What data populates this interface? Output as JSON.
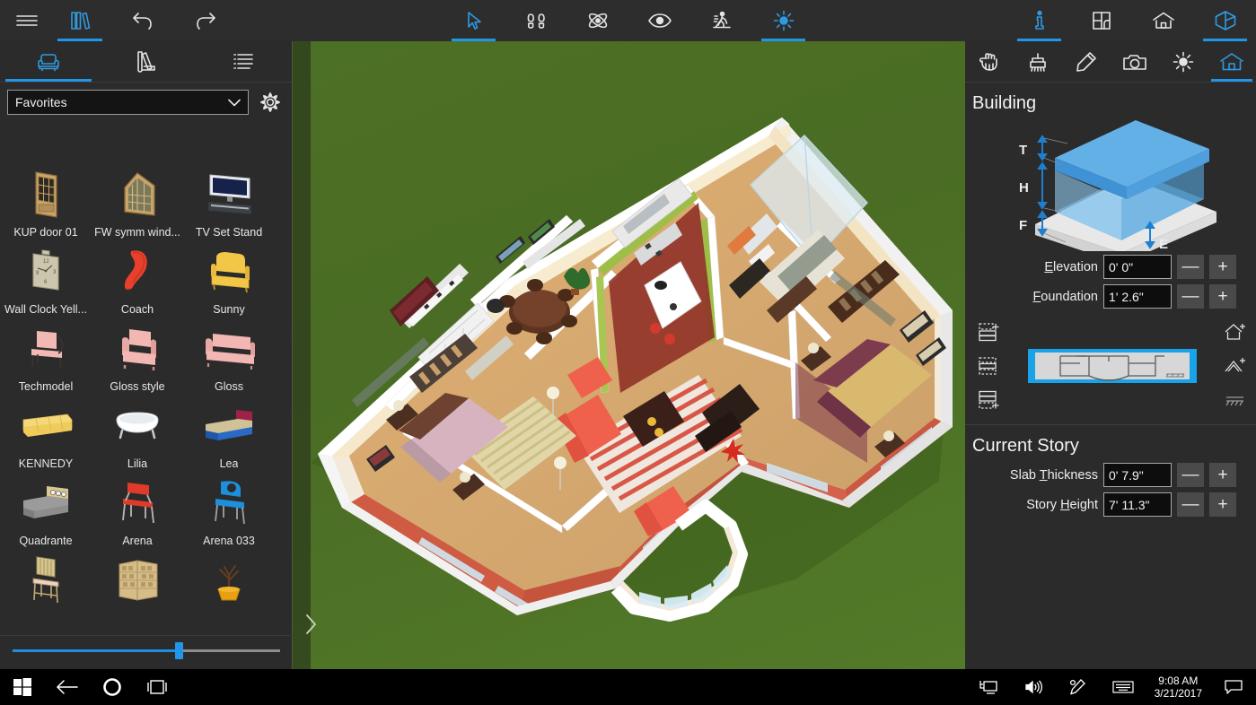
{
  "app": {
    "name": "Live Home 3D",
    "accent": "#2196e8"
  },
  "topbar": {
    "left": [
      {
        "name": "menu-icon",
        "label": "Menu",
        "active": false
      },
      {
        "name": "library-icon",
        "label": "Library",
        "active": true
      },
      {
        "name": "undo-icon",
        "label": "Undo",
        "active": false
      },
      {
        "name": "redo-icon",
        "label": "Redo",
        "active": false
      }
    ],
    "center": [
      {
        "name": "select-arrow-icon",
        "label": "Select",
        "active": true
      },
      {
        "name": "footprints-icon",
        "label": "Walk",
        "active": false
      },
      {
        "name": "atom-orbit-icon",
        "label": "Orbit",
        "active": false
      },
      {
        "name": "eye-icon",
        "label": "Look",
        "active": false
      },
      {
        "name": "person-ramp-icon",
        "label": "Elevation",
        "active": false
      },
      {
        "name": "sun-icon",
        "label": "Lighting",
        "active": true
      }
    ],
    "right": [
      {
        "name": "info-icon",
        "label": "Info",
        "active": true
      },
      {
        "name": "floorplan-icon",
        "label": "Floor Plan",
        "active": false
      },
      {
        "name": "house-icon",
        "label": "Interior",
        "active": false
      },
      {
        "name": "cube-3d-icon",
        "label": "3D View",
        "active": true
      }
    ]
  },
  "left_panel": {
    "tabs": [
      {
        "name": "objects-tab",
        "icon": "armchair-icon",
        "label": "Objects",
        "active": true
      },
      {
        "name": "materials-tab",
        "icon": "swatch-icon",
        "label": "Materials",
        "active": false
      },
      {
        "name": "list-tab",
        "icon": "list-icon",
        "label": "List",
        "active": false
      }
    ],
    "category": {
      "value": "Favorites",
      "chevron": "⌄"
    },
    "settings_label": "Settings",
    "items": [
      {
        "label": "KUP door 01",
        "icon": "door-thumb"
      },
      {
        "label": "FW symm wind...",
        "icon": "window-thumb"
      },
      {
        "label": "TV Set Stand",
        "icon": "tv-thumb"
      },
      {
        "label": "Wall Clock Yell...",
        "icon": "clock-thumb"
      },
      {
        "label": "Coach",
        "icon": "redchair-thumb"
      },
      {
        "label": "Sunny",
        "icon": "yellowarmchair-thumb"
      },
      {
        "label": "Techmodel",
        "icon": "pinkchair-thumb"
      },
      {
        "label": "Gloss style",
        "icon": "pinkarmchair-thumb"
      },
      {
        "label": "Gloss",
        "icon": "pinksofa-thumb"
      },
      {
        "label": "KENNEDY",
        "icon": "yellowsofa-thumb"
      },
      {
        "label": "Lilia",
        "icon": "bathtub-thumb"
      },
      {
        "label": "Lea",
        "icon": "bed-thumb"
      },
      {
        "label": "Quadrante",
        "icon": "graybed-thumb"
      },
      {
        "label": "Arena",
        "icon": "redchair2-thumb"
      },
      {
        "label": "Arena 033",
        "icon": "bluechair-thumb"
      },
      {
        "label": "",
        "icon": "woodchair-thumb"
      },
      {
        "label": "",
        "icon": "bookshelf-thumb"
      },
      {
        "label": "",
        "icon": "plant-thumb"
      }
    ],
    "zoom_slider": {
      "value": 62,
      "min": 0,
      "max": 100
    }
  },
  "viewport": {
    "expand_icon": "chevron-right-icon",
    "expand_label": "Expand"
  },
  "right_panel": {
    "tabs": [
      {
        "name": "object-tab",
        "icon": "hand-icon",
        "label": "Object",
        "active": false
      },
      {
        "name": "paint-tab",
        "icon": "paint-roller-icon",
        "label": "Material",
        "active": false
      },
      {
        "name": "edit-tab",
        "icon": "pencil-icon",
        "label": "Edit",
        "active": false
      },
      {
        "name": "camera-tab",
        "icon": "camera-icon",
        "label": "Camera",
        "active": false
      },
      {
        "name": "light-tab",
        "icon": "sun-icon",
        "label": "Light",
        "active": false
      },
      {
        "name": "building-tab",
        "icon": "house-front-icon",
        "label": "Building",
        "active": true
      }
    ],
    "building": {
      "title": "Building",
      "diagram_labels": {
        "top": "T",
        "height": "H",
        "foundation": "F",
        "elevation": "E"
      },
      "fields": [
        {
          "name": "elevation-field",
          "label": "Elevation",
          "accel": "E",
          "value": "0' 0\""
        },
        {
          "name": "foundation-field",
          "label": "Foundation",
          "accel": "F",
          "value": "1' 2.6\""
        }
      ],
      "minus_label": "—",
      "plus_label": "+"
    },
    "story_controls": {
      "left_icons": [
        {
          "name": "add-story-above-icon",
          "label": "Add Story Above"
        },
        {
          "name": "current-story-icon",
          "label": "Current Story"
        },
        {
          "name": "add-story-below-icon",
          "label": "Add Story Below"
        }
      ],
      "right_icons": [
        {
          "name": "add-roof-icon",
          "label": "Add Roof"
        },
        {
          "name": "edit-roof-icon",
          "label": "Edit Roof"
        },
        {
          "name": "remove-roof-icon",
          "label": "Remove Roof"
        }
      ],
      "plan_preview_label": "Story Plan Preview"
    },
    "current_story": {
      "title": "Current Story",
      "fields": [
        {
          "name": "slab-thickness-field",
          "label": "Slab Thickness",
          "accel": "T",
          "value": "0' 7.9\""
        },
        {
          "name": "story-height-field",
          "label": "Story Height",
          "accel": "H",
          "value": "7' 11.3\""
        }
      ],
      "minus_label": "—",
      "plus_label": "+"
    }
  },
  "taskbar": {
    "left": [
      {
        "name": "windows-start-button",
        "label": "Start"
      },
      {
        "name": "back-button",
        "label": "Back"
      },
      {
        "name": "cortana-button",
        "label": "Cortana"
      },
      {
        "name": "task-view-button",
        "label": "Task View"
      }
    ],
    "right": [
      {
        "name": "network-display-icon",
        "label": "Network"
      },
      {
        "name": "volume-icon",
        "label": "Volume"
      },
      {
        "name": "pen-workspace-icon",
        "label": "Windows Ink"
      },
      {
        "name": "touch-keyboard-icon",
        "label": "Touch Keyboard"
      }
    ],
    "clock": {
      "time": "9:08 AM",
      "date": "3/21/2017"
    },
    "action_center": {
      "name": "action-center-icon",
      "label": "Notifications"
    }
  }
}
